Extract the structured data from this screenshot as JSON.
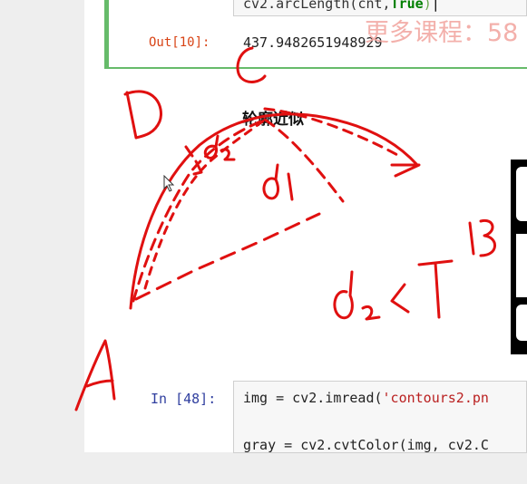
{
  "top_cell": {
    "code": "cv2.arcLength(cnt,True)",
    "code_prefix": "cv2.arcLength(",
    "code_arg": "cnt,",
    "code_true": "True",
    "code_suffix": ")",
    "out_prompt": "Out[10]:",
    "out_value": "437.9482651948929"
  },
  "watermark": "更多课程：58",
  "heading": "轮廓近似",
  "bottom_cell": {
    "in_prompt": "In [48]:",
    "line1_prefix": "img = cv2.imread(",
    "line1_str": "'contours2.pn",
    "line2": "gray = cv2.cvtColor(img, cv2.C"
  },
  "annotations": {
    "C": "C",
    "D": "D",
    "A": "A",
    "B": "B",
    "d1": "d1",
    "d2": "d2",
    "d2_lt_T": "d2<T"
  },
  "colors": {
    "ink": "#e01010",
    "accent": "#66bb6a"
  }
}
